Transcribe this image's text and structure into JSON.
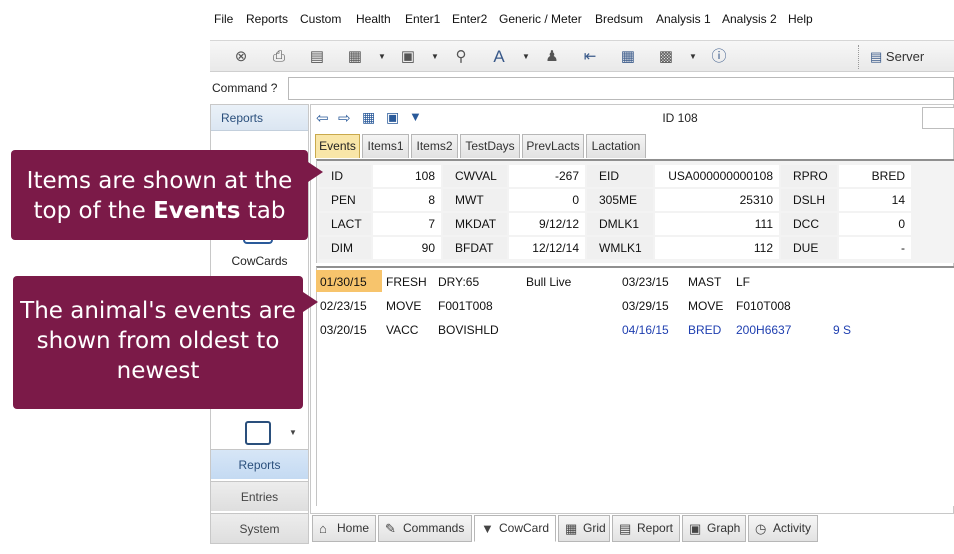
{
  "menu": [
    "File",
    "Reports",
    "Custom",
    "Health",
    "Enter1",
    "Enter2",
    "Generic / Meter",
    "Bredsum",
    "Analysis 1",
    "Analysis 2",
    "Help"
  ],
  "toolbar": {
    "server_label": "Server"
  },
  "command": {
    "label": "Command ?"
  },
  "left_panel": {
    "header": "Reports",
    "cowcards_label": "CowCards",
    "nav": [
      "Reports",
      "Entries",
      "System"
    ]
  },
  "cowcard": {
    "id_label": "ID 108",
    "tabs": [
      "Events",
      "Items1",
      "Items2",
      "TestDays",
      "PrevLacts",
      "Lactation"
    ],
    "active_tab": "Events"
  },
  "items": [
    [
      "ID",
      "108",
      "CWVAL",
      "-267",
      "EID",
      "USA000000000108",
      "RPRO",
      "BRED"
    ],
    [
      "PEN",
      "8",
      "MWT",
      "0",
      "305ME",
      "25310",
      "DSLH",
      "14"
    ],
    [
      "LACT",
      "7",
      "MKDAT",
      "9/12/12",
      "DMLK1",
      "111",
      "DCC",
      "0"
    ],
    [
      "DIM",
      "90",
      "BFDAT",
      "12/12/14",
      "WMLK1",
      "112",
      "DUE",
      "-"
    ]
  ],
  "events_left": [
    {
      "date": "01/30/15",
      "event": "FRESH",
      "remark": "DRY:65",
      "extra": "Bull Live"
    },
    {
      "date": "02/23/15",
      "event": "MOVE",
      "remark": "F001T008",
      "extra": ""
    },
    {
      "date": "03/20/15",
      "event": "VACC",
      "remark": "BOVISHLD",
      "extra": ""
    }
  ],
  "events_right": [
    {
      "date": "03/23/15",
      "event": "MAST",
      "remark": "LF",
      "extra": ""
    },
    {
      "date": "03/29/15",
      "event": "MOVE",
      "remark": "F010T008",
      "extra": ""
    },
    {
      "date": "04/16/15",
      "event": "BRED",
      "remark": "200H6637",
      "extra": "9 S"
    }
  ],
  "bottom_tabs": [
    "Home",
    "Commands",
    "CowCard",
    "Grid",
    "Report",
    "Graph",
    "Activity"
  ],
  "callouts": {
    "c1_pre": "Items are shown at the top of the ",
    "c1_bold": "Events",
    "c1_post": " tab",
    "c2": "The animal's events are shown from oldest to newest"
  },
  "colors": {
    "callout": "#7b1a48",
    "active_tab": "#f9e6a8",
    "event_highlight": "#f7c46c",
    "future_event": "#1f3fb0"
  }
}
